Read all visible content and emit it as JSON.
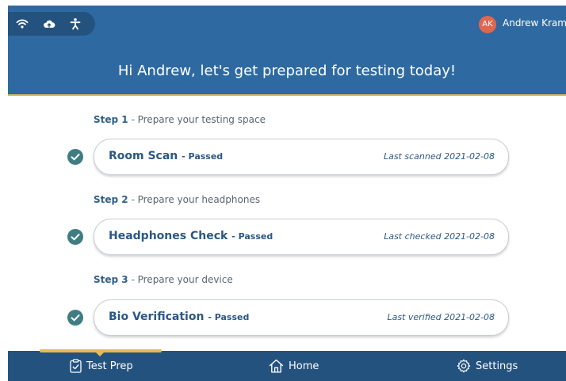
{
  "header": {
    "greeting": "Hi Andrew, let's get prepared for testing today!",
    "user": {
      "initials": "AK",
      "name": "Andrew Kramer"
    },
    "status_icons": [
      "wifi-icon",
      "cloud-upload-icon",
      "accessibility-icon"
    ]
  },
  "steps": [
    {
      "step_label": "Step 1",
      "description": "- Prepare your testing space",
      "title": "Room Scan",
      "status": "- Passed",
      "date_text": "Last scanned 2021-02-08"
    },
    {
      "step_label": "Step 2",
      "description": "- Prepare your headphones",
      "title": "Headphones Check",
      "status": "- Passed",
      "date_text": "Last checked 2021-02-08"
    },
    {
      "step_label": "Step 3",
      "description": "- Prepare your device",
      "title": "Bio Verification",
      "status": "- Passed",
      "date_text": "Last verified 2021-02-08"
    }
  ],
  "nav": {
    "items": [
      {
        "label": "Test Prep",
        "icon": "clipboard-check-icon",
        "active": true
      },
      {
        "label": "Home",
        "icon": "home-icon",
        "active": false
      },
      {
        "label": "Settings",
        "icon": "gear-icon",
        "active": false
      }
    ]
  },
  "colors": {
    "header": "#2e6aa1",
    "nav": "#24527f",
    "accent": "#e6b85c",
    "check": "#3f7d82",
    "avatar": "#e0664f"
  }
}
